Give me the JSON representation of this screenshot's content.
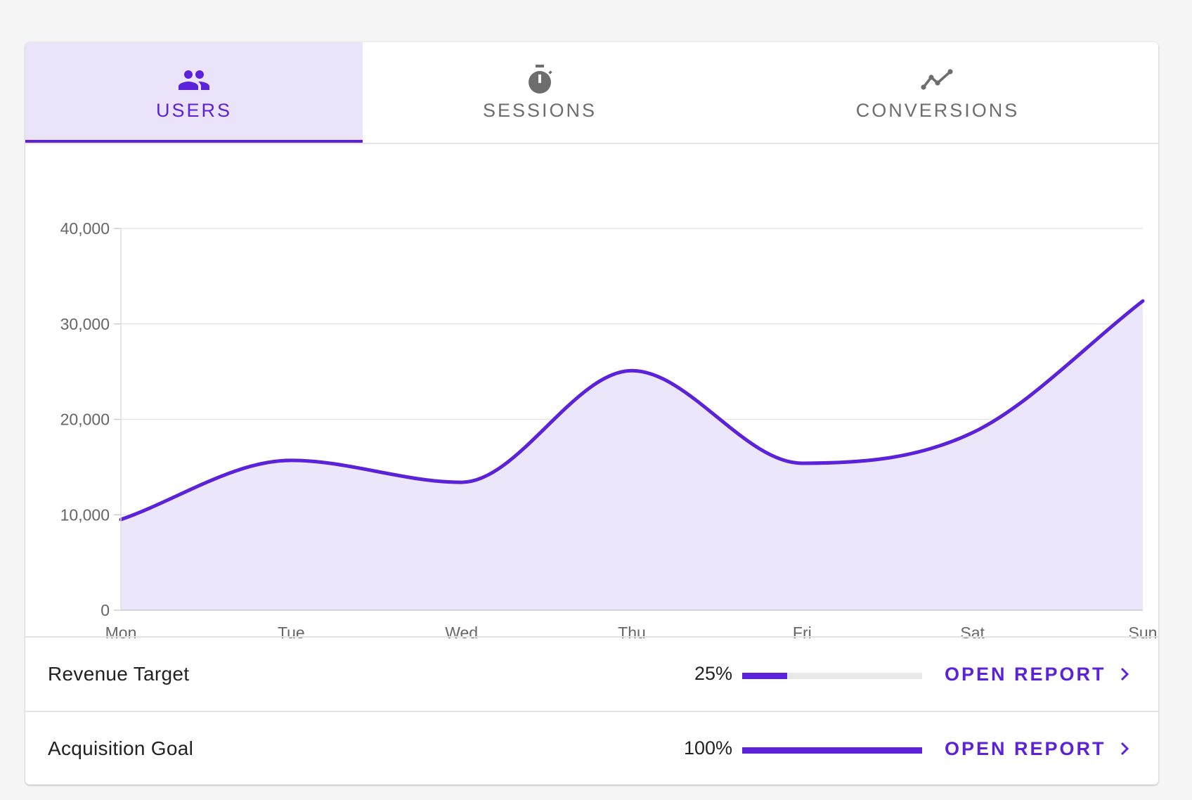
{
  "tabs": [
    {
      "label": "USERS",
      "icon": "group-icon",
      "active": true
    },
    {
      "label": "SESSIONS",
      "icon": "timer-icon",
      "active": false
    },
    {
      "label": "CONVERSIONS",
      "icon": "trend-line-icon",
      "active": false
    }
  ],
  "colors": {
    "accent": "#5b22d9",
    "area_fill": "#ece6fb",
    "active_tab_bg": "#ebe3fa"
  },
  "chart_data": {
    "type": "area",
    "title": "",
    "xlabel": "",
    "ylabel": "",
    "categories": [
      "Mon",
      "Tue",
      "Wed",
      "Thu",
      "Fri",
      "Sat",
      "Sun"
    ],
    "series": [
      {
        "values": [
          9500,
          15700,
          13400,
          25100,
          15400,
          18600,
          32400
        ]
      }
    ],
    "ylim": [
      0,
      40000
    ],
    "yticks": [
      0,
      10000,
      20000,
      30000,
      40000
    ],
    "ytick_labels": [
      "0",
      "10,000",
      "20,000",
      "30,000",
      "40,000"
    ],
    "grid": true,
    "smooth": true
  },
  "rows": [
    {
      "title": "Revenue Target",
      "percent_label": "25%",
      "progress": 0.25,
      "action": "OPEN REPORT"
    },
    {
      "title": "Acquisition Goal",
      "percent_label": "100%",
      "progress": 1.0,
      "action": "OPEN REPORT"
    }
  ]
}
